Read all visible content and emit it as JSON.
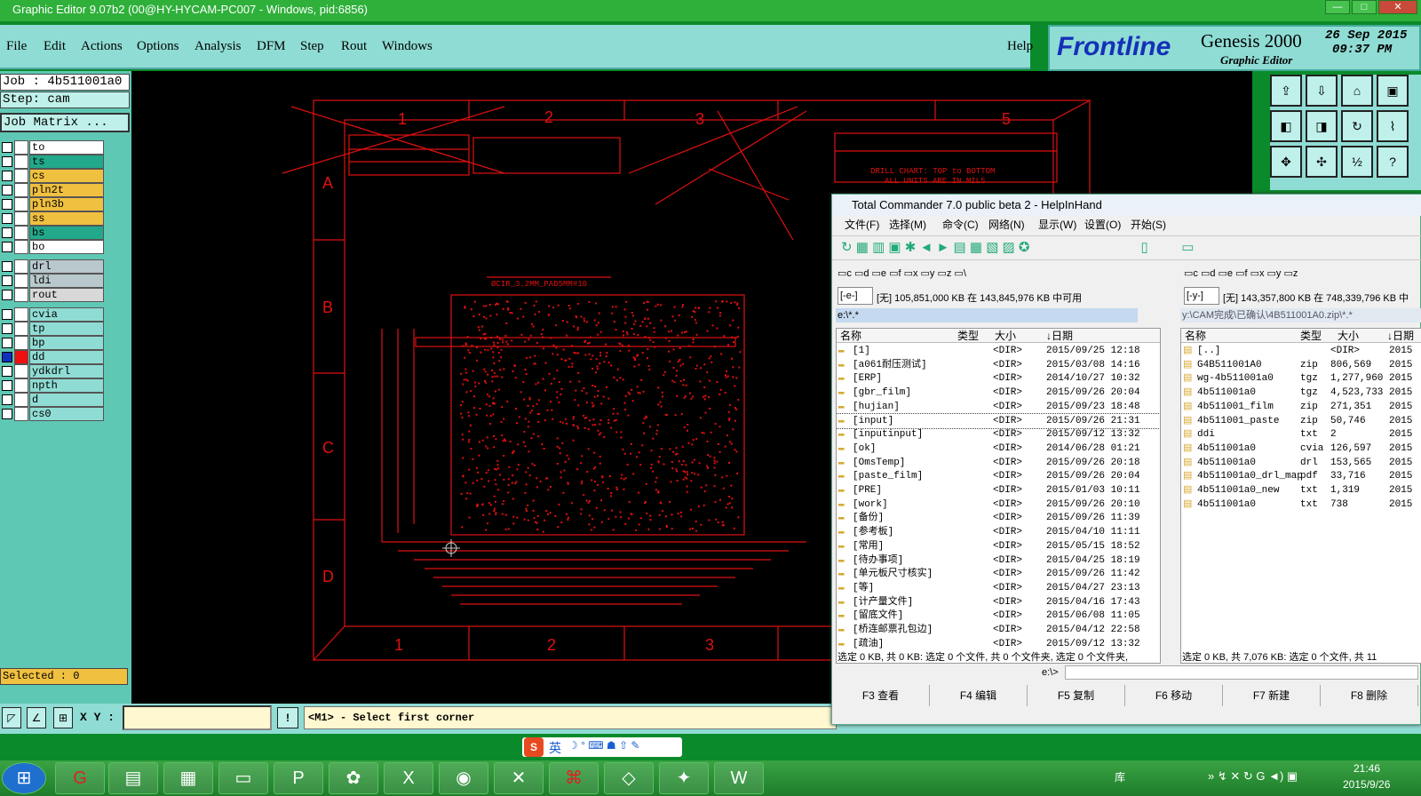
{
  "window": {
    "title": "Graphic Editor 9.07b2 (00@HY-HYCAM-PC007 - Windows, pid:6856)"
  },
  "menu": {
    "items": [
      "File",
      "Edit",
      "Actions",
      "Options",
      "Analysis",
      "DFM",
      "Step",
      "Rout",
      "Windows"
    ],
    "help": "Help"
  },
  "brand": {
    "logo": "Frontline",
    "product": "Genesis 2000",
    "subtitle": "Graphic Editor",
    "date": "26 Sep 2015",
    "time": "09:37 PM"
  },
  "job": {
    "job_line": "Job : 4b511001a0",
    "step_line": "Step: cam",
    "matrix_button": "Job Matrix ..."
  },
  "layers": [
    {
      "name": "to",
      "color": "#ffffff"
    },
    {
      "name": "ts",
      "color": "#22a88a"
    },
    {
      "name": "cs",
      "color": "#f0c040"
    },
    {
      "name": "pln2t",
      "color": "#f0c040"
    },
    {
      "name": "pln3b",
      "color": "#f0c040"
    },
    {
      "name": "ss",
      "color": "#f0c040"
    },
    {
      "name": "bs",
      "color": "#22a88a"
    },
    {
      "name": "bo",
      "color": "#ffffff"
    },
    {
      "name": "drl",
      "color": "#b8c8cc"
    },
    {
      "name": "ldi",
      "color": "#b8c8cc"
    },
    {
      "name": "rout",
      "color": "#d8d8d8"
    },
    {
      "name": "cvia",
      "color": "#8fdcd4"
    },
    {
      "name": "tp",
      "color": "#8fdcd4"
    },
    {
      "name": "bp",
      "color": "#8fdcd4"
    },
    {
      "name": "dd",
      "color": "#8fdcd4"
    },
    {
      "name": "ydkdrl",
      "color": "#8fdcd4"
    },
    {
      "name": "npth",
      "color": "#8fdcd4"
    },
    {
      "name": "d",
      "color": "#8fdcd4"
    },
    {
      "name": "cs0",
      "color": "#8fdcd4"
    }
  ],
  "selected": "Selected : 0",
  "bottom": {
    "xy_label": "X Y :",
    "xy_value": "",
    "prompt": "<M1> - Select first corner"
  },
  "ime": {
    "lang": "英"
  },
  "canvas": {
    "cols": [
      "1",
      "2",
      "3",
      "5"
    ],
    "rows": [
      "A",
      "B",
      "C",
      "D"
    ],
    "bottom_cols": [
      "1",
      "2",
      "3"
    ],
    "drill_chart": "DRILL CHART: TOP to BOTTOM",
    "units": "ALL UNITS ARE IN MILS",
    "pad_label": "ØCIR_3.2MM_PAD5MM#10"
  },
  "tc": {
    "title": "Total Commander 7.0 public beta 2 - HelpInHand",
    "menu": [
      "文件(F)",
      "选择(M)",
      "命令(C)",
      "网络(N)",
      "显示(W)",
      "设置(O)",
      "开始(S)"
    ],
    "left_drive": "[-e-]",
    "left_free": "[无] 105,851,000 KB 在 143,845,976 KB 中可用",
    "left_path": "e:\\*.*",
    "right_drive": "[-y-]",
    "right_free": "[无] 143,357,800 KB 在 748,339,796 KB 中",
    "right_path": "y:\\CAM完成\\已确认\\4B511001A0.zip\\*.*",
    "left_cols": [
      "名称",
      "类型",
      "大小",
      "↓日期"
    ],
    "right_cols": [
      "名称",
      "类型",
      "大小",
      "↓日期"
    ],
    "left_rows": [
      {
        "name": "[1]",
        "size": "<DIR>",
        "date": "2015/09/25 12:18"
      },
      {
        "name": "[a061耐压测试]",
        "size": "<DIR>",
        "date": "2015/03/08 14:16"
      },
      {
        "name": "[ERP]",
        "size": "<DIR>",
        "date": "2014/10/27 10:32"
      },
      {
        "name": "[gbr_film]",
        "size": "<DIR>",
        "date": "2015/09/26 20:04"
      },
      {
        "name": "[hujian]",
        "size": "<DIR>",
        "date": "2015/09/23 18:48"
      },
      {
        "name": "[input]",
        "size": "<DIR>",
        "date": "2015/09/26 21:31"
      },
      {
        "name": "[inputinput]",
        "size": "<DIR>",
        "date": "2015/09/12 13:32"
      },
      {
        "name": "[ok]",
        "size": "<DIR>",
        "date": "2014/06/28 01:21"
      },
      {
        "name": "[OmsTemp]",
        "size": "<DIR>",
        "date": "2015/09/26 20:18"
      },
      {
        "name": "[paste_film]",
        "size": "<DIR>",
        "date": "2015/09/26 20:04"
      },
      {
        "name": "[PRE]",
        "size": "<DIR>",
        "date": "2015/01/03 10:11"
      },
      {
        "name": "[work]",
        "size": "<DIR>",
        "date": "2015/09/26 20:10"
      },
      {
        "name": "[备份]",
        "size": "<DIR>",
        "date": "2015/09/26 11:39"
      },
      {
        "name": "[参考板]",
        "size": "<DIR>",
        "date": "2015/04/10 11:11"
      },
      {
        "name": "[常用]",
        "size": "<DIR>",
        "date": "2015/05/15 18:52"
      },
      {
        "name": "[待办事项]",
        "size": "<DIR>",
        "date": "2015/04/25 18:19"
      },
      {
        "name": "[单元板尺寸核实]",
        "size": "<DIR>",
        "date": "2015/09/26 11:42"
      },
      {
        "name": "[等]",
        "size": "<DIR>",
        "date": "2015/04/27 23:13"
      },
      {
        "name": "[计产量文件]",
        "size": "<DIR>",
        "date": "2015/04/16 17:43"
      },
      {
        "name": "[留底文件]",
        "size": "<DIR>",
        "date": "2015/06/08 11:05"
      },
      {
        "name": "[桥连邮票孔包边]",
        "size": "<DIR>",
        "date": "2015/04/12 22:58"
      },
      {
        "name": "[疏油]",
        "size": "<DIR>",
        "date": "2015/09/12 13:32"
      }
    ],
    "right_rows": [
      {
        "name": "[..]",
        "type": "",
        "size": "<DIR>",
        "date": "2015"
      },
      {
        "name": "G4B511001A0",
        "type": "zip",
        "size": "806,569",
        "date": "2015"
      },
      {
        "name": "wg-4b511001a0",
        "type": "tgz",
        "size": "1,277,960",
        "date": "2015"
      },
      {
        "name": "4b511001a0",
        "type": "tgz",
        "size": "4,523,733",
        "date": "2015"
      },
      {
        "name": "4b511001_film",
        "type": "zip",
        "size": "271,351",
        "date": "2015"
      },
      {
        "name": "4b511001_paste",
        "type": "zip",
        "size": "50,746",
        "date": "2015"
      },
      {
        "name": "ddi",
        "type": "txt",
        "size": "2",
        "date": "2015"
      },
      {
        "name": "4b511001a0",
        "type": "cvia",
        "size": "126,597",
        "date": "2015"
      },
      {
        "name": "4b511001a0",
        "type": "drl",
        "size": "153,565",
        "date": "2015"
      },
      {
        "name": "4b511001a0_drl_map",
        "type": "pdf",
        "size": "33,716",
        "date": "2015"
      },
      {
        "name": "4b511001a0_new",
        "type": "txt",
        "size": "1,319",
        "date": "2015"
      },
      {
        "name": "4b511001a0",
        "type": "txt",
        "size": "738",
        "date": "2015"
      }
    ],
    "status_left": "选定 0 KB, 共 0 KB: 选定 0 个文件, 共 0 个文件夹, 选定 0 个文件夹,",
    "status_right": "选定 0 KB, 共 7,076 KB: 选定 0 个文件, 共 11",
    "cmd_path": "e:\\>",
    "fkeys": [
      "F3 查看",
      "F4 编辑",
      "F5 复制",
      "F6 移动",
      "F7 新建",
      "F8 删除"
    ]
  },
  "clock": {
    "time": "21:46",
    "date": "2015/9/26",
    "tray_label": "库"
  }
}
